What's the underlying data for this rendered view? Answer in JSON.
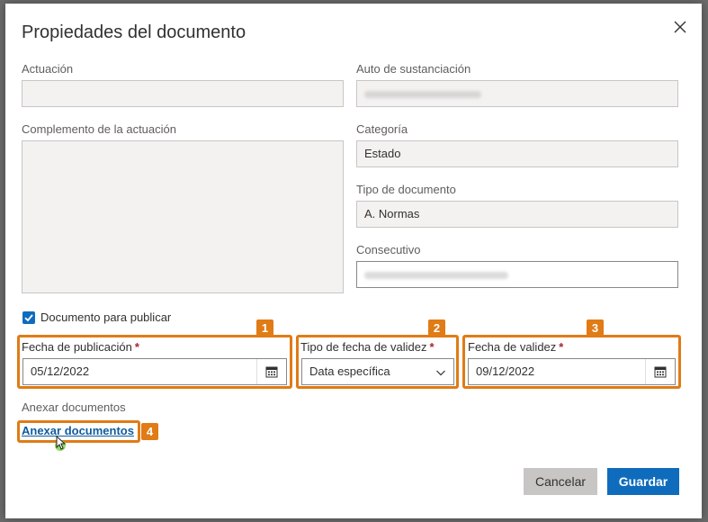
{
  "dialog": {
    "title": "Propiedades del documento",
    "close_icon": "close-icon"
  },
  "left": {
    "actuacion_label": "Actuación",
    "actuacion_value": "",
    "complemento_label": "Complemento de la actuación",
    "complemento_value": ""
  },
  "right": {
    "auto_label": "Auto de sustanciación",
    "categoria_label": "Categoría",
    "categoria_value": "Estado",
    "tipo_doc_label": "Tipo de documento",
    "tipo_doc_value": "A. Normas",
    "consecutivo_label": "Consecutivo"
  },
  "publish": {
    "checkbox_label": "Documento para publicar",
    "checked": true
  },
  "dates": {
    "fecha_pub_label": "Fecha de publicación",
    "fecha_pub_value": "05/12/2022",
    "tipo_fecha_label": "Tipo de fecha de validez",
    "tipo_fecha_value": "Data específica",
    "fecha_validez_label": "Fecha de validez",
    "fecha_validez_value": "09/12/2022",
    "required_mark": "*"
  },
  "attachments": {
    "section_label": "Anexar documentos",
    "link_label": "Anexar documentos"
  },
  "badges": {
    "b1": "1",
    "b2": "2",
    "b3": "3",
    "b4": "4"
  },
  "buttons": {
    "cancel": "Cancelar",
    "save": "Guardar"
  },
  "colors": {
    "highlight": "#e07b16",
    "primary": "#0f6cbd",
    "required": "#a4262c"
  }
}
